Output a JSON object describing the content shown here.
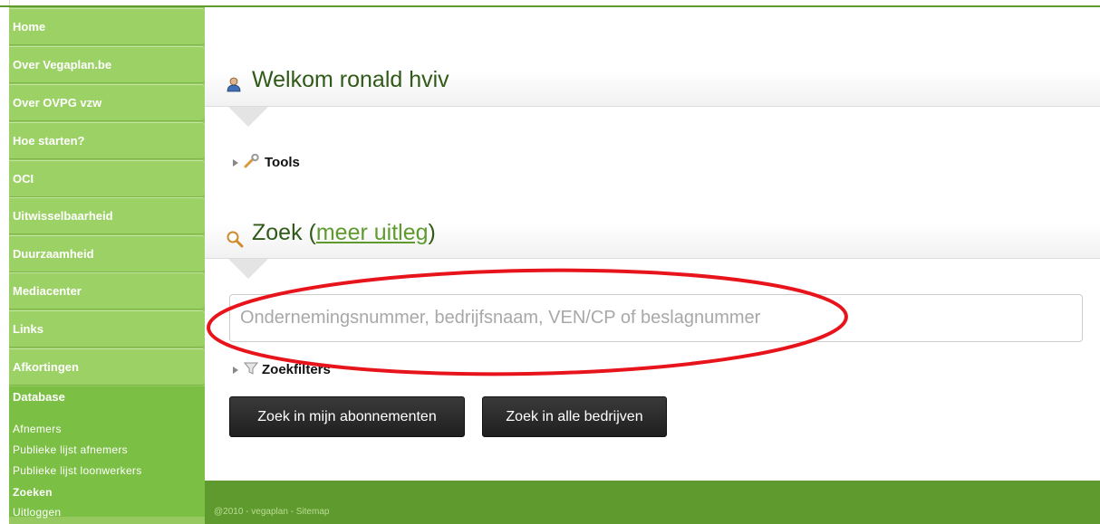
{
  "sidebar": {
    "items": [
      {
        "label": "Home"
      },
      {
        "label": "Over Vegaplan.be"
      },
      {
        "label": "Over OVPG vzw"
      },
      {
        "label": "Hoe starten?"
      },
      {
        "label": "OCI"
      },
      {
        "label": "Uitwisselbaarheid"
      },
      {
        "label": "Duurzaamheid"
      },
      {
        "label": "Mediacenter"
      },
      {
        "label": "Links"
      },
      {
        "label": "Afkortingen"
      }
    ],
    "database": {
      "label": "Database",
      "subitems": [
        {
          "label": "Afnemers"
        },
        {
          "label": "Publieke lijst afnemers"
        },
        {
          "label": "Publieke lijst loonwerkers"
        },
        {
          "label": "Zoeken"
        },
        {
          "label": "Uitloggen"
        }
      ]
    }
  },
  "welcome": {
    "title": "Welkom ronald hviv",
    "icon": "user-icon",
    "tools_label": "Tools",
    "tools_icon": "wrench-icon"
  },
  "search": {
    "title": "Zoek (",
    "link": "meer uitleg",
    "title_end": ")",
    "icon": "magnifier-icon",
    "placeholder": "Ondernemingsnummer, bedrijfsnaam, VEN/CP of beslagnummer",
    "filters_label": "Zoekfilters",
    "filters_icon": "funnel-icon",
    "btn_subscriptions": "Zoek in mijn abonnementen",
    "btn_all": "Zoek in alle bedrijven"
  },
  "footer": {
    "text": "@2010 - vegaplan - Sitemap"
  },
  "colors": {
    "sidebar": "#9cd166",
    "sidebar_active": "#7cbf45",
    "footer": "#5f9a2f",
    "heading": "#2f5a17",
    "annotation": "#e8141c"
  }
}
